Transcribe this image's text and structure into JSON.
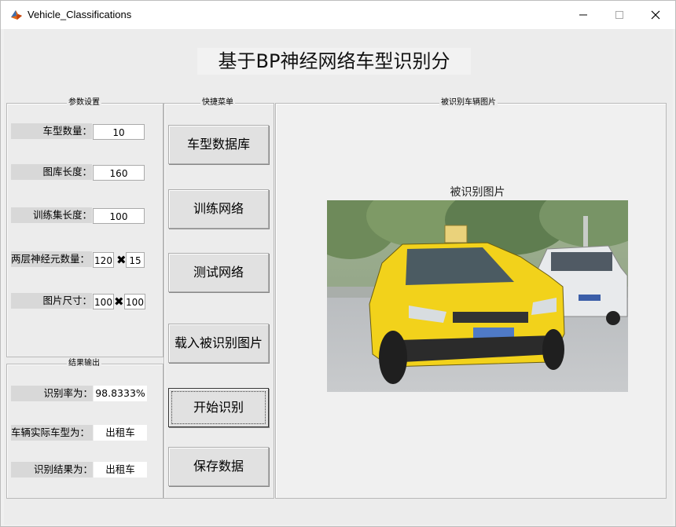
{
  "window": {
    "title": "Vehicle_Classifications",
    "controls": [
      "minimize-icon",
      "maximize-icon",
      "close-icon"
    ]
  },
  "header": {
    "title": "基于BP神经网络车型识别分"
  },
  "params_panel": {
    "title": "参数设置",
    "car_types_label": "车型数量：",
    "car_types_value": "10",
    "gallery_length_label": "图库长度：",
    "gallery_length_value": "160",
    "training_length_label": "训练集长度：",
    "training_length_value": "100",
    "neurons_label": "两层神经元数量：",
    "neurons_value_1": "120",
    "neurons_value_2": "15",
    "image_size_label": "图片尺寸：",
    "image_size_w": "100",
    "image_size_h": "100"
  },
  "results_panel": {
    "title": "结果输出",
    "accuracy_label": "识别率为：",
    "accuracy_value": "98.8333%",
    "actual_type_label": "车辆实际车型为：",
    "actual_type_value": "出租车",
    "result_label": "识别结果为：",
    "result_value": "出租车"
  },
  "menu_panel": {
    "title": "快捷菜单",
    "buttons": {
      "database": "车型数据库",
      "train": "训练网络",
      "test": "测试网络",
      "load_image": "载入被识别图片",
      "start": "开始识别",
      "save": "保存数据"
    }
  },
  "image_panel": {
    "title": "被识别车辆图片",
    "axes_title": "被识别图片"
  },
  "colors": {
    "window_bg": "#ececec",
    "label_bg": "#d8d8d8",
    "button_bg": "#e1e1e1",
    "taxi_yellow": "#f2d21b"
  }
}
